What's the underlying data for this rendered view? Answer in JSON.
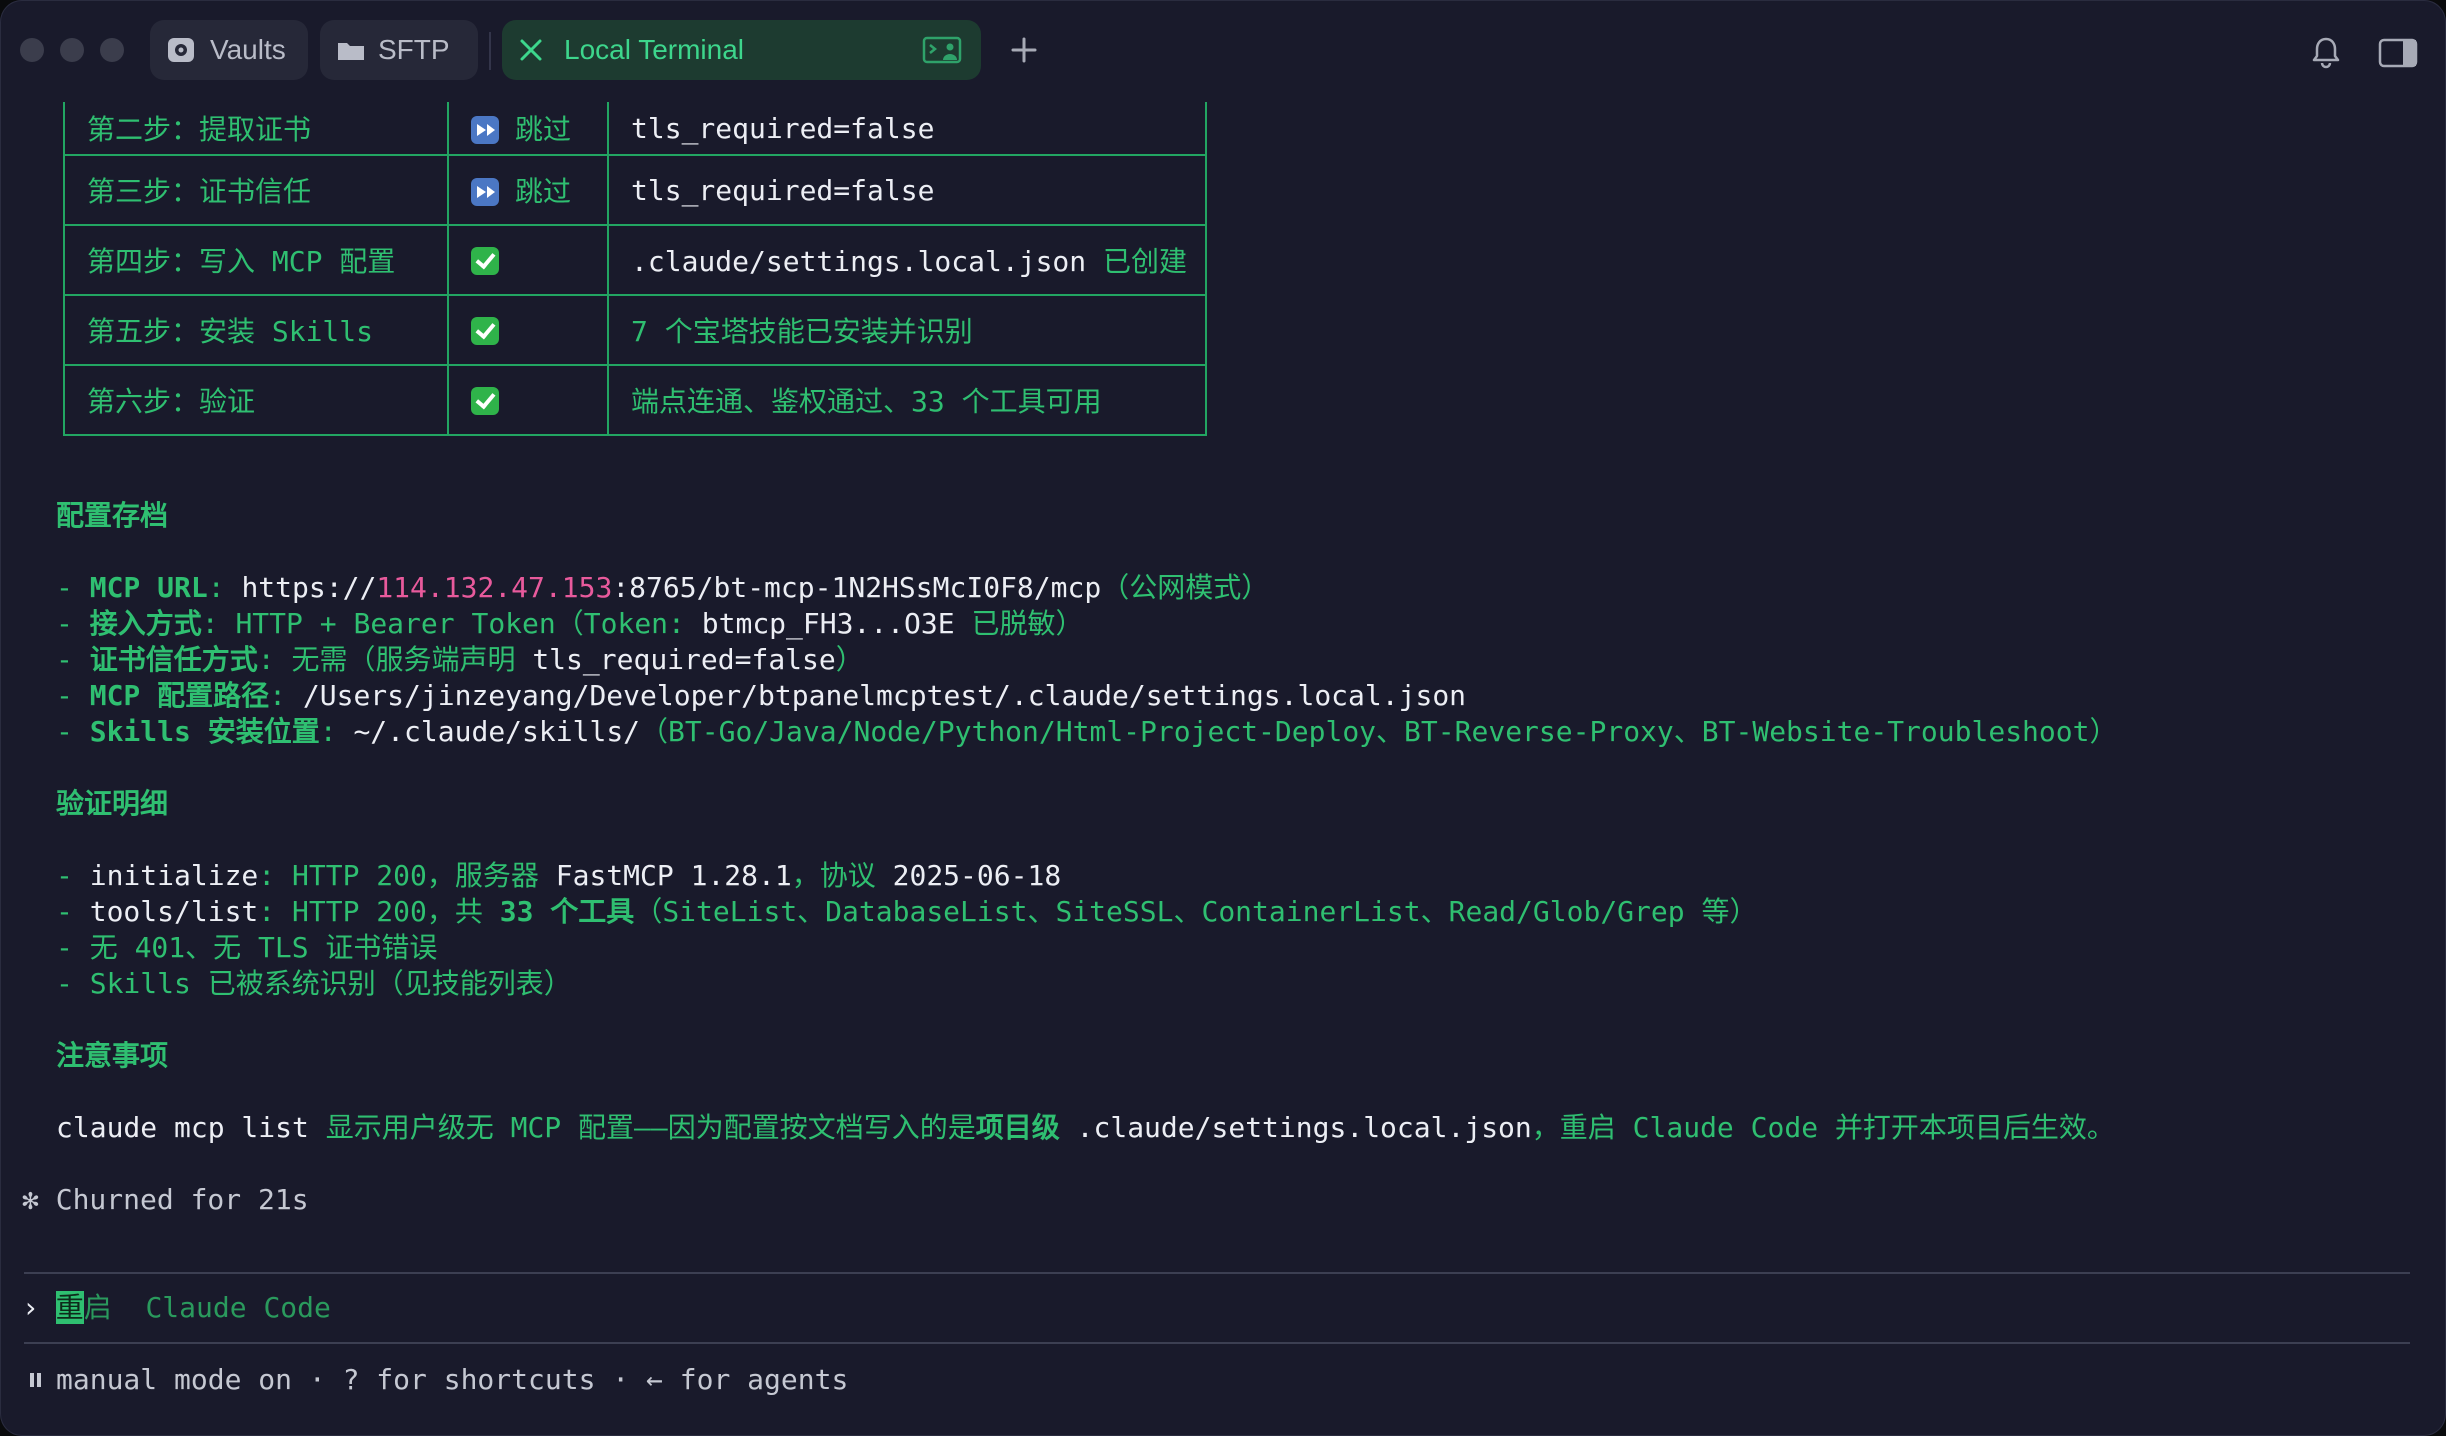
{
  "tabs": [
    {
      "label": "Vaults",
      "icon": "vault-icon"
    },
    {
      "label": "SFTP",
      "icon": "folder-icon"
    },
    {
      "label": "Local Terminal",
      "icon": "close-icon",
      "active": true,
      "badge_icon": "terminal-user-icon"
    }
  ],
  "titlebar": {
    "new_tab_icon": "plus-icon",
    "notifications_icon": "bell-icon",
    "sidebar_icon": "sidebar-toggle-icon"
  },
  "steps_table": [
    {
      "step": "第二步：提取证书",
      "status": "skip",
      "status_label": "跳过",
      "detail": "tls_required=false"
    },
    {
      "step": "第三步：证书信任",
      "status": "skip",
      "status_label": "跳过",
      "detail": "tls_required=false"
    },
    {
      "step": "第四步：写入 MCP 配置",
      "status": "done",
      "status_label": "",
      "detail_mono": ".claude/settings.local.json",
      "detail": " 已创建"
    },
    {
      "step": "第五步：安装 Skills",
      "status": "done",
      "status_label": "",
      "detail": "7 个宝塔技能已安装并识别"
    },
    {
      "step": "第六步：验证",
      "status": "done",
      "status_label": "",
      "detail": "端点连通、鉴权通过、33 个工具可用"
    }
  ],
  "config": {
    "heading": "配置存档",
    "mcp_url_key": "MCP URL",
    "mcp_url_prefix": "https://",
    "mcp_url_host": "114.132.47.153",
    "mcp_url_rest": ":8765/bt-mcp-1N2HSsMcI0F8/mcp",
    "mcp_url_note": "（公网模式）",
    "access_key": "接入方式",
    "access_value": "HTTP + Bearer Token（Token: ",
    "access_token": "btmcp_FH3...O3E",
    "access_tail": " 已脱敏）",
    "cert_key": "证书信任方式",
    "cert_value": "无需（服务端声明 ",
    "cert_flag": "tls_required=false",
    "cert_tail": "）",
    "path_key": "MCP 配置路径",
    "path_value": "/Users/jinzeyang/Developer/btpanelmcptest/.claude/settings.local.json",
    "skills_key": "Skills 安装位置",
    "skills_path": "~/.claude/skills/",
    "skills_list": "（BT-Go/Java/Node/Python/Html-Project-Deploy、BT-Reverse-Proxy、BT-Website-Troubleshoot）"
  },
  "verify": {
    "heading": "验证明细",
    "init_key": "initialize",
    "init_a": ": HTTP 200，服务器 ",
    "init_server": "FastMCP 1.28.1",
    "init_b": "，协议 ",
    "init_proto": "2025-06-18",
    "tools_key": "tools/list",
    "tools_a": ": HTTP 200，共 ",
    "tools_bold": "33 个工具",
    "tools_list": "（SiteList、DatabaseList、SiteSSL、ContainerList、Read/Glob/Grep 等）",
    "no_errors": "- 无 401、无 TLS 证书错误",
    "skills_line": "- Skills 已被系统识别（见技能列表）"
  },
  "notes": {
    "heading": "注意事项",
    "cmd": "claude mcp list",
    "a": " 显示用户级无 MCP 配置——因为配置按文档写入的是",
    "bold": "项目级",
    "file": " .claude/settings.local.json",
    "b": "，重启 Claude Code 并打开本项目后生效。"
  },
  "status": {
    "churn": "✻ Churned for 21s"
  },
  "prompt": {
    "chevron": "›",
    "cursor_char": "重",
    "suggestion": "启  Claude Code"
  },
  "footer": {
    "text": "manual mode on · ? for shortcuts · ← for agents"
  }
}
